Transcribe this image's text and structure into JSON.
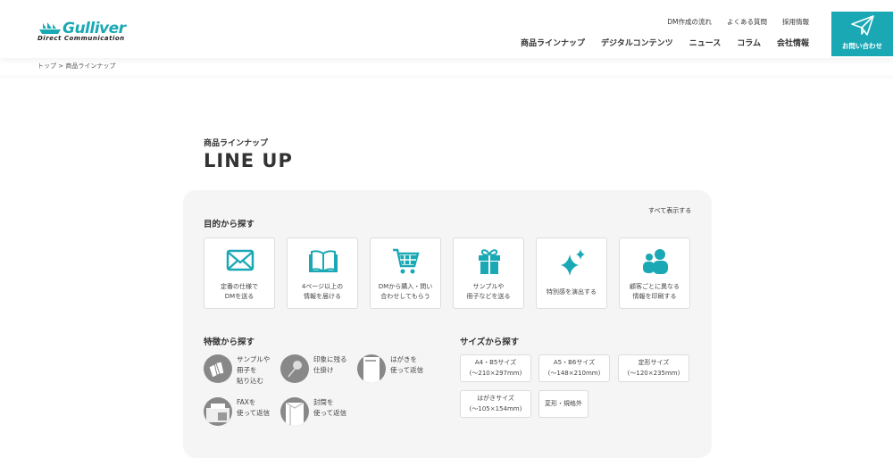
{
  "header": {
    "logo_name": "Gulliver",
    "logo_sub": "Direct Communication",
    "subnav": [
      "DM作成の流れ",
      "よくある質問",
      "採用情報"
    ],
    "mainnav": [
      "商品ラインナップ",
      "デジタルコンテンツ",
      "ニュース",
      "コラム",
      "会社情報"
    ],
    "contact": "お問い合わせ"
  },
  "breadcrumb": "トップ > 商品ラインナップ",
  "page": {
    "eyebrow": "商品ラインナップ",
    "title": "LINE UP"
  },
  "panel": {
    "show_all": "すべて表示する",
    "purpose_heading": "目的から探す",
    "purposes": [
      {
        "icon": "envelope-icon",
        "label": "定番の仕様で\nDMを送る"
      },
      {
        "icon": "book-icon",
        "label": "4ページ以上の\n情報を届ける"
      },
      {
        "icon": "cart-icon",
        "label": "DMから購入・問い\n合わせしてもらう"
      },
      {
        "icon": "gift-icon",
        "label": "サンプルや\n冊子などを送る"
      },
      {
        "icon": "sparkle-icon",
        "label": "特別感を演出する"
      },
      {
        "icon": "people-icon",
        "label": "顧客ごとに異なる\n情報を印刷する"
      }
    ],
    "feature_heading": "特徴から探す",
    "features": [
      {
        "icon": "cards-icon",
        "label": "サンプルや\n冊子を\n貼り込む"
      },
      {
        "icon": "pin-icon",
        "label": "印象に残る\n仕掛け"
      },
      {
        "icon": "postcard-icon",
        "label": "はがきを\n使って返信"
      },
      {
        "icon": "fax-icon",
        "label": "FAXを\n使って返信"
      },
      {
        "icon": "envelope-return-icon",
        "label": "封筒を\n使って返信"
      }
    ],
    "size_heading": "サイズから探す",
    "sizes": [
      "A4・B5サイズ\n(〜210×297mm)",
      "A5・B6サイズ\n(〜148×210mm)",
      "定形サイズ\n(〜120×235mm)",
      "はがきサイズ\n(〜105×154mm)",
      "変形・規格外"
    ]
  },
  "colors": {
    "accent": "#1aa8b5",
    "panel": "#f5f5f5",
    "feature_icon": "#888888"
  }
}
